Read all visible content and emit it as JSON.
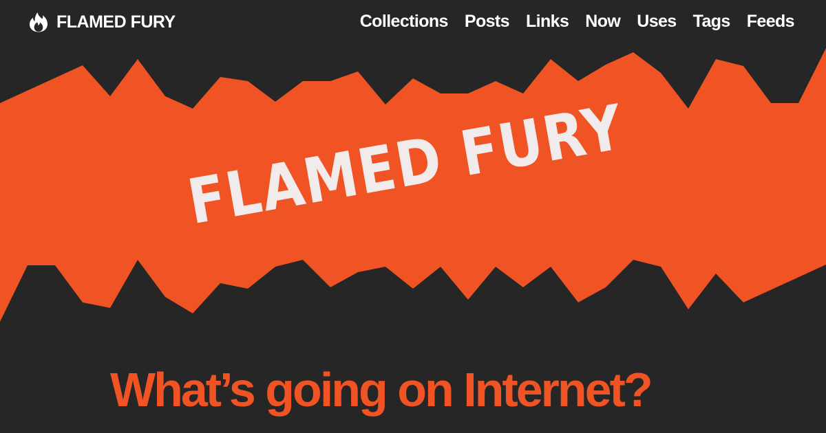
{
  "colors": {
    "background": "#262626",
    "accent": "#f05324",
    "banner_text": "#f2ebeb",
    "header_text": "#ffffff"
  },
  "brand": {
    "icon": "flame-icon",
    "name": "FLAMED FURY"
  },
  "nav": {
    "items": [
      {
        "label": "Collections"
      },
      {
        "label": "Posts"
      },
      {
        "label": "Links"
      },
      {
        "label": "Now"
      },
      {
        "label": "Uses"
      },
      {
        "label": "Tags"
      },
      {
        "label": "Feeds"
      }
    ]
  },
  "banner": {
    "title": "FLAMED FURY"
  },
  "tagline": "What’s going on Internet?"
}
